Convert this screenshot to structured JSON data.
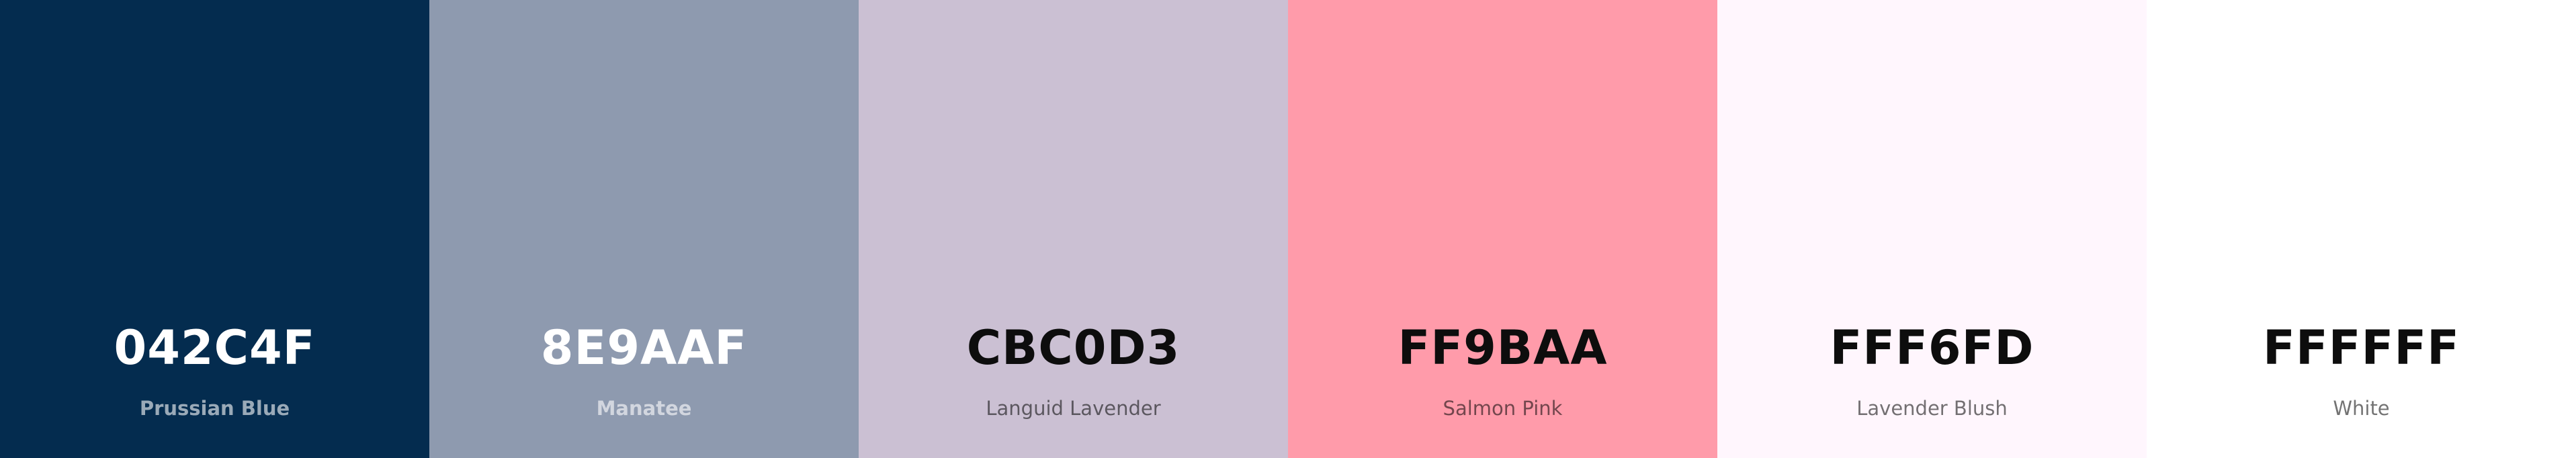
{
  "palette": {
    "swatches": [
      {
        "hex": "042C4F",
        "name": "Prussian Blue",
        "color": "#042C4F",
        "tone": "dark"
      },
      {
        "hex": "8E9AAF",
        "name": "Manatee",
        "color": "#8E9AAF",
        "tone": "dark"
      },
      {
        "hex": "CBC0D3",
        "name": "Languid Lavender",
        "color": "#CBC0D3",
        "tone": "light"
      },
      {
        "hex": "FF9BAA",
        "name": "Salmon Pink",
        "color": "#FF9BAA",
        "tone": "light"
      },
      {
        "hex": "FFF6FD",
        "name": "Lavender Blush",
        "color": "#FFF6FD",
        "tone": "light"
      },
      {
        "hex": "FFFFFF",
        "name": "White",
        "color": "#FFFFFF",
        "tone": "light"
      }
    ]
  }
}
